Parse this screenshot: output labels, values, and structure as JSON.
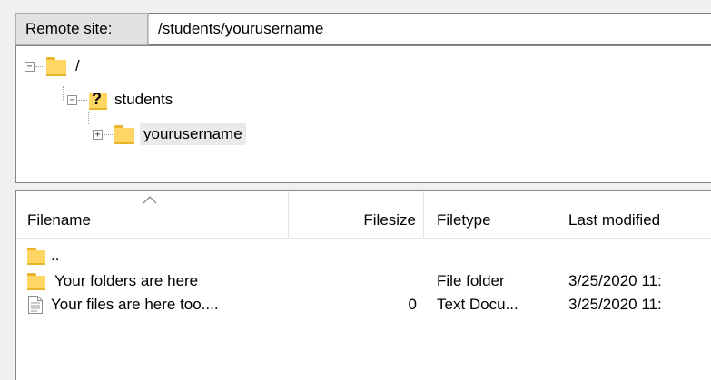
{
  "remote_site": {
    "label": "Remote site:",
    "path": "/students/yourusername"
  },
  "tree": {
    "nodes": [
      {
        "label": "/",
        "expander": "−",
        "icon": "folder-icon"
      },
      {
        "label": "students",
        "expander": "−",
        "icon": "unknown-folder-icon"
      },
      {
        "label": "yourusername",
        "expander": "+",
        "icon": "folder-icon"
      }
    ]
  },
  "list": {
    "columns": {
      "filename": "Filename",
      "filesize": "Filesize",
      "filetype": "Filetype",
      "modified": "Last modified"
    },
    "sort_icon": "sort-ascending-icon",
    "rows": [
      {
        "name": "..",
        "size": "",
        "type": "",
        "modified": "",
        "icon": "folder-icon"
      },
      {
        "name": "Your folders are here",
        "size": "",
        "type": "File folder",
        "modified": "3/25/2020 11:",
        "icon": "folder-icon"
      },
      {
        "name": "Your files are here too....",
        "size": "0",
        "type": "Text Docu...",
        "modified": "3/25/2020 11:",
        "icon": "text-document-icon"
      }
    ]
  },
  "colors": {
    "folder": "#ffd664",
    "folder_dark": "#e8b52a",
    "selection": "#eaeaea",
    "border": "#828790"
  }
}
